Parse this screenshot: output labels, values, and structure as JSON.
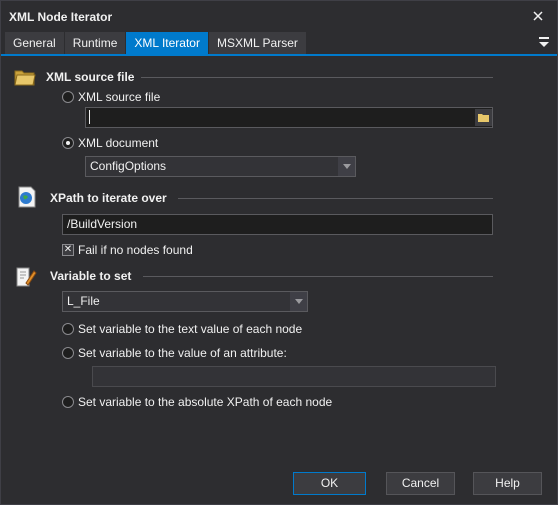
{
  "window": {
    "title": "XML Node Iterator"
  },
  "tabs": [
    {
      "label": "General",
      "active": false
    },
    {
      "label": "Runtime",
      "active": false
    },
    {
      "label": "XML Iterator",
      "active": true
    },
    {
      "label": "MSXML Parser",
      "active": false
    }
  ],
  "xml_source": {
    "title": "XML source file",
    "option_file_label": "XML source file",
    "file_value": "",
    "option_document_label": "XML document",
    "selected": "document",
    "document_value": "ConfigOptions"
  },
  "xpath": {
    "title": "XPath to iterate over",
    "value": "/BuildVersion",
    "fail_label": "Fail if no nodes found",
    "fail_checked": true
  },
  "variable": {
    "title": "Variable to set",
    "value": "L_File",
    "option_text_label": "Set variable to the text value of each node",
    "option_attr_label": "Set variable to the value of an attribute:",
    "attr_value": "",
    "option_xpath_label": "Set variable to the absolute XPath of each node"
  },
  "buttons": {
    "ok": "OK",
    "cancel": "Cancel",
    "help": "Help"
  },
  "colors": {
    "accent": "#007acc",
    "background": "#2d2d30"
  }
}
